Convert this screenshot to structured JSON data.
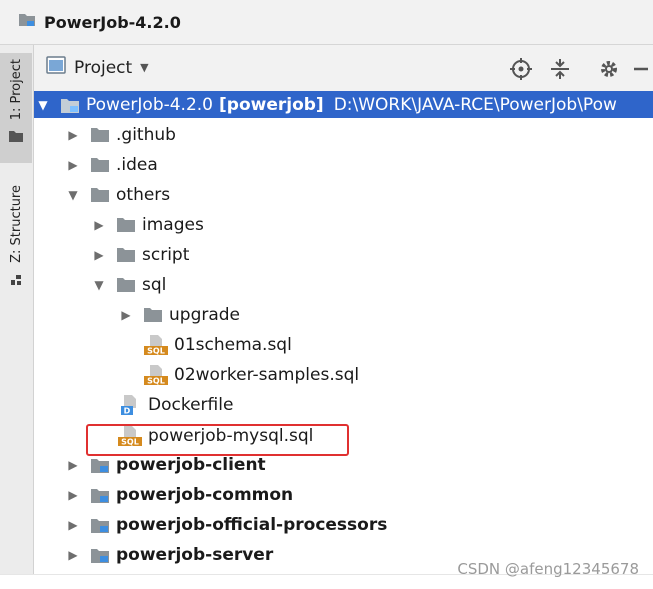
{
  "window": {
    "title": "PowerJob-4.2.0"
  },
  "side_tabs": {
    "project": "1: Project",
    "structure": "Z: Structure"
  },
  "toolbar": {
    "view_label": "Project"
  },
  "tree": {
    "root": {
      "name": "PowerJob-4.2.0",
      "module": "[powerjob]",
      "path": "D:\\WORK\\JAVA-RCE\\PowerJob\\Pow"
    },
    "github": ".github",
    "idea": ".idea",
    "others": "others",
    "images": "images",
    "script": "script",
    "sql": "sql",
    "upgrade": "upgrade",
    "schema": "01schema.sql",
    "worker_samples": "02worker-samples.sql",
    "dockerfile": "Dockerfile",
    "mysql": "powerjob-mysql.sql",
    "client": "powerjob-client",
    "common": "powerjob-common",
    "official": "powerjob-official-processors",
    "server": "powerjob-server"
  },
  "file_badges": {
    "sql": "SQL",
    "docker": "D"
  },
  "watermark": "CSDN @afeng12345678",
  "colors": {
    "selection": "#2f65ca",
    "highlight_box": "#e03030",
    "folder": "#8c9398",
    "sql_icon": "#d58a1e",
    "module_blue": "#3d8ee0"
  }
}
